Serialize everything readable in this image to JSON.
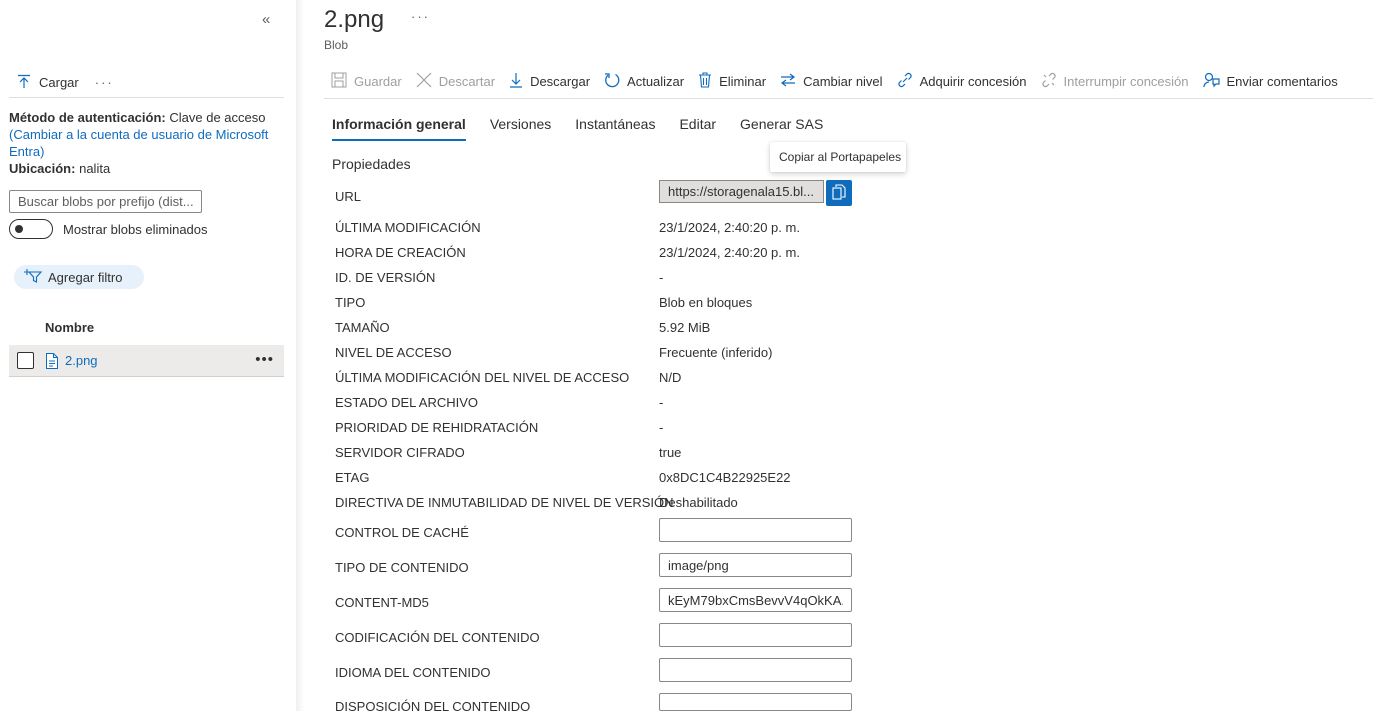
{
  "left": {
    "collapse_glyph": "«",
    "toolbar": {
      "upload_label": "Cargar",
      "more_glyph": "···"
    },
    "auth": {
      "method_label": "Método de autenticación:",
      "method_value": "Clave de acceso",
      "switch_link": "(Cambiar a la cuenta de usuario de Microsoft Entra)",
      "location_label": "Ubicación:",
      "location_value": "nalita"
    },
    "search": {
      "placeholder": "Buscar blobs por prefijo (dist..."
    },
    "show_deleted_label": "Mostrar blobs eliminados",
    "add_filter_label": "Agregar filtro",
    "column_name": "Nombre",
    "files": [
      {
        "name": "2.png"
      }
    ],
    "row_more_glyph": "•••"
  },
  "header": {
    "title": "2.png",
    "subtitle": "Blob",
    "more_glyph": "···"
  },
  "commands": [
    {
      "label": "Guardar",
      "icon": "save-icon",
      "disabled": true
    },
    {
      "label": "Descartar",
      "icon": "discard-icon",
      "disabled": true
    },
    {
      "label": "Descargar",
      "icon": "download-icon",
      "disabled": false
    },
    {
      "label": "Actualizar",
      "icon": "refresh-icon",
      "disabled": false
    },
    {
      "label": "Eliminar",
      "icon": "delete-icon",
      "disabled": false
    },
    {
      "label": "Cambiar nivel",
      "icon": "change-tier-icon",
      "disabled": false
    },
    {
      "label": "Adquirir concesión",
      "icon": "acquire-lease-icon",
      "disabled": false
    },
    {
      "label": "Interrumpir concesión",
      "icon": "break-lease-icon",
      "disabled": true
    },
    {
      "label": "Enviar comentarios",
      "icon": "feedback-icon",
      "disabled": false
    }
  ],
  "tabs": [
    "Información general",
    "Versiones",
    "Instantáneas",
    "Editar",
    "Generar SAS"
  ],
  "active_tab": "Información general",
  "section_title": "Propiedades",
  "url": {
    "label": "URL",
    "value": "https://storagenala15.bl...",
    "copy_tooltip": "Copiar al Portapapeles"
  },
  "properties": [
    {
      "label": "ÚLTIMA MODIFICACIÓN",
      "value": "23/1/2024, 2:40:20 p. m."
    },
    {
      "label": "HORA DE CREACIÓN",
      "value": "23/1/2024, 2:40:20 p. m."
    },
    {
      "label": "ID. DE VERSIÓN",
      "value": "-"
    },
    {
      "label": "TIPO",
      "value": "Blob en bloques"
    },
    {
      "label": "TAMAÑO",
      "value": "5.92 MiB"
    },
    {
      "label": "NIVEL DE ACCESO",
      "value": "Frecuente (inferido)"
    },
    {
      "label": "ÚLTIMA MODIFICACIÓN DEL NIVEL DE ACCESO",
      "value": "N/D"
    },
    {
      "label": "ESTADO DEL ARCHIVO",
      "value": "-"
    },
    {
      "label": "PRIORIDAD DE REHIDRATACIÓN",
      "value": "-"
    },
    {
      "label": "SERVIDOR CIFRADO",
      "value": "true"
    },
    {
      "label": "ETAG",
      "value": "0x8DC1C4B22925E22"
    },
    {
      "label": "DIRECTIVA DE INMUTABILIDAD DE NIVEL DE VERSIÓN",
      "value": "Deshabilitado"
    }
  ],
  "editable": [
    {
      "label": "CONTROL DE CACHÉ",
      "value": ""
    },
    {
      "label": "TIPO DE CONTENIDO",
      "value": "image/png"
    },
    {
      "label": "CONTENT-MD5",
      "value": "kEyM79bxCmsBevvV4qOkKA..."
    },
    {
      "label": "CODIFICACIÓN DEL CONTENIDO",
      "value": ""
    },
    {
      "label": "IDIOMA DEL CONTENIDO",
      "value": ""
    },
    {
      "label": "DISPOSICIÓN DEL CONTENIDO",
      "value": ""
    }
  ],
  "colors": {
    "accent": "#0f6cbd",
    "disabled": "#a19f9d",
    "text": "#323130"
  }
}
